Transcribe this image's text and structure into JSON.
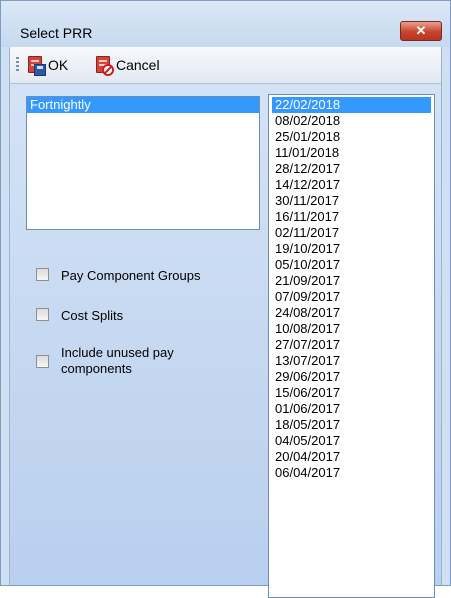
{
  "window": {
    "title": "Select PRR",
    "close_icon": "close-x-icon"
  },
  "toolbar": {
    "ok_label": "OK",
    "ok_icon": "save-document-icon",
    "cancel_label": "Cancel",
    "cancel_icon": "cancel-document-icon"
  },
  "frequency_list": {
    "items": [
      "Fortnightly"
    ],
    "selected": "Fortnightly"
  },
  "date_list": {
    "items": [
      "22/02/2018",
      "08/02/2018",
      "25/01/2018",
      "11/01/2018",
      "28/12/2017",
      "14/12/2017",
      "30/11/2017",
      "16/11/2017",
      "02/11/2017",
      "19/10/2017",
      "05/10/2017",
      "21/09/2017",
      "07/09/2017",
      "24/08/2017",
      "10/08/2017",
      "27/07/2017",
      "13/07/2017",
      "29/06/2017",
      "15/06/2017",
      "01/06/2017",
      "18/05/2017",
      "04/05/2017",
      "20/04/2017",
      "06/04/2017"
    ],
    "selected": "22/02/2018"
  },
  "options": {
    "pay_component_groups": {
      "label": "Pay Component Groups",
      "checked": false
    },
    "cost_splits": {
      "label": "Cost Splits",
      "checked": false
    },
    "include_unused": {
      "label": "Include unused pay components",
      "checked": false
    }
  },
  "colors": {
    "selection": "#3399ff",
    "close_button": "#c7432d",
    "panel": "#c9dcf2"
  }
}
